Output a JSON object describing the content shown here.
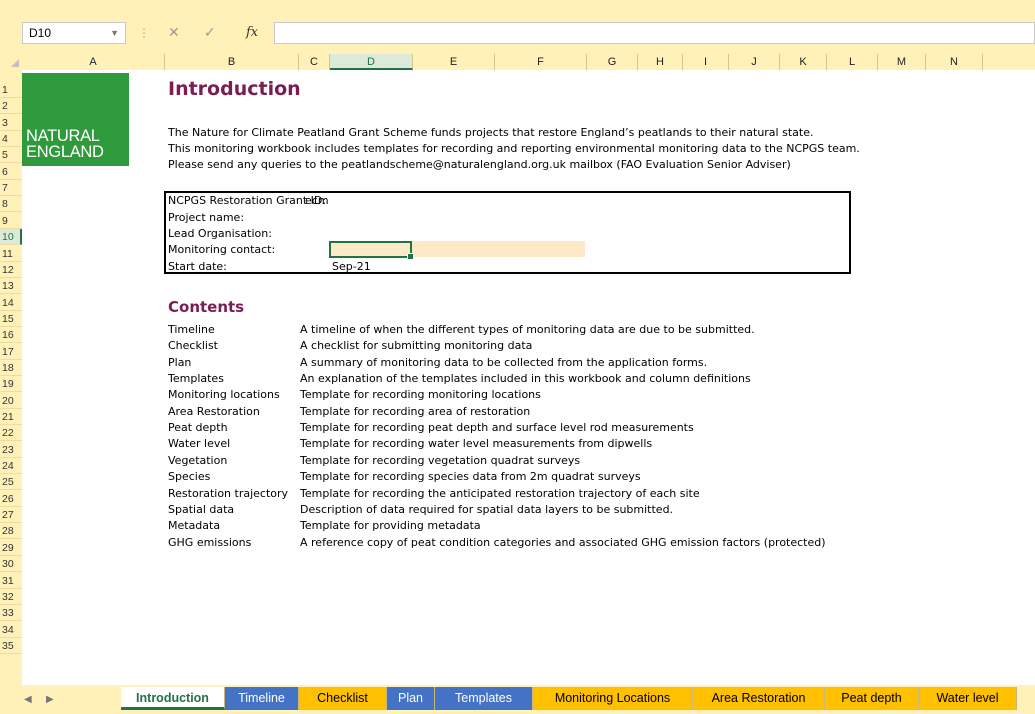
{
  "formula_bar": {
    "name_box": "D10",
    "cancel_icon": "✕",
    "enter_icon": "✓",
    "fx_label": "fx",
    "formula_value": ""
  },
  "columns": [
    "A",
    "B",
    "C",
    "D",
    "E",
    "F",
    "G",
    "H",
    "I",
    "J",
    "K",
    "L",
    "M",
    "N"
  ],
  "selected_column": "D",
  "selected_row": "10",
  "logo": {
    "line1": "NATURAL",
    "line2": "ENGLAND"
  },
  "sheet": {
    "title": "Introduction",
    "intro_lines": [
      "The Nature for Climate Peatland Grant Scheme funds projects that restore England’s peatlands to their natural state.",
      "This monitoring workbook includes templates for recording and reporting environmental monitoring data to the NCPGS team.",
      "Please send any queries to the peatlandscheme@naturalengland.org.uk mailbox (FAO Evaluation Senior Adviser)"
    ],
    "project_fields": [
      {
        "label": "NCPGS Restoration Grant ID:",
        "value": "ecm"
      },
      {
        "label": "Project name:",
        "value": ""
      },
      {
        "label": "Lead Organisation:",
        "value": ""
      },
      {
        "label": "Monitoring contact:",
        "value": ""
      },
      {
        "label": "Start date:",
        "value": "Sep-21"
      }
    ],
    "contents_heading": "Contents",
    "contents": [
      {
        "name": "Timeline",
        "desc": "A timeline of when the different types of monitoring data are due to be submitted."
      },
      {
        "name": "Checklist",
        "desc": "A checklist for submitting monitoring data"
      },
      {
        "name": "Plan",
        "desc": "A summary of monitoring data to be collected from the application forms."
      },
      {
        "name": "Templates",
        "desc": "An explanation of the templates included in this workbook and column definitions"
      },
      {
        "name": "Monitoring locations",
        "desc": "Template for recording monitoring locations"
      },
      {
        "name": "Area Restoration",
        "desc": "Template for recording area of restoration"
      },
      {
        "name": "Peat depth",
        "desc": "Template for recording peat depth and surface level rod measurements"
      },
      {
        "name": "Water level",
        "desc": "Template for recording water level measurements from dipwells"
      },
      {
        "name": "Vegetation",
        "desc": "Template for recording vegetation quadrat surveys"
      },
      {
        "name": "Species",
        "desc": "Template for recording species data from 2m quadrat surveys"
      },
      {
        "name": "Restoration trajectory",
        "desc": "Template for recording the anticipated restoration trajectory of each site"
      },
      {
        "name": "Spatial data",
        "desc": "Description of data required for spatial data layers to be submitted."
      },
      {
        "name": "Metadata",
        "desc": "Template for providing metadata"
      },
      {
        "name": "GHG emissions",
        "desc": "A reference copy of peat condition categories and associated GHG emission factors (protected)"
      }
    ]
  },
  "tabs": [
    {
      "label": "Introduction",
      "color": "#ffffff",
      "active": true
    },
    {
      "label": "Timeline",
      "color": "#4472c4"
    },
    {
      "label": "Checklist",
      "color": "#ffc000"
    },
    {
      "label": "Plan",
      "color": "#4472c4"
    },
    {
      "label": "Templates",
      "color": "#4472c4"
    },
    {
      "label": "Monitoring Locations",
      "color": "#ffc000"
    },
    {
      "label": "Area Restoration",
      "color": "#ffc000"
    },
    {
      "label": "Peat depth",
      "color": "#ffc000"
    },
    {
      "label": "Water level",
      "color": "#ffc000"
    }
  ],
  "tab_nav": {
    "prev": "◀",
    "next": "▶"
  }
}
